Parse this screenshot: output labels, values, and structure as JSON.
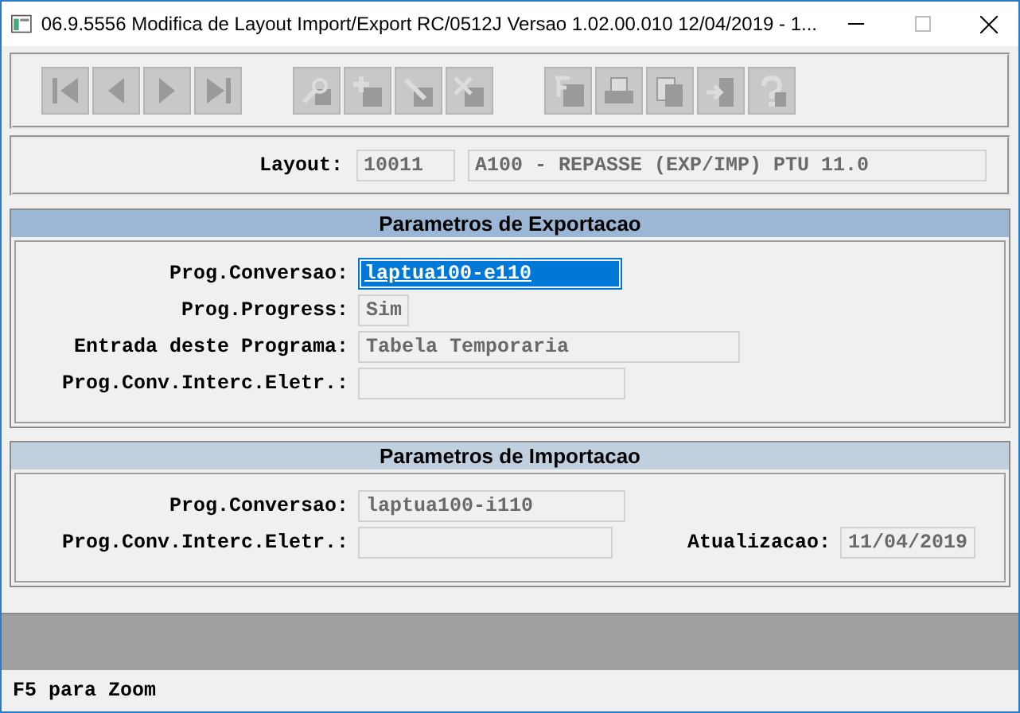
{
  "window": {
    "title": "06.9.5556  Modifica  de Layout Import/Export RC/0512J Versao 1.02.00.010 12/04/2019 - 1..."
  },
  "toolbar": {
    "groups": [
      [
        {
          "kind": "first",
          "disabled": true
        },
        {
          "kind": "prev",
          "disabled": true
        },
        {
          "kind": "next",
          "disabled": true
        },
        {
          "kind": "last",
          "disabled": true
        }
      ],
      [
        {
          "kind": "search",
          "disabled": true
        },
        {
          "kind": "add",
          "disabled": true
        },
        {
          "kind": "edit",
          "disabled": true
        },
        {
          "kind": "delete",
          "disabled": true
        }
      ],
      [
        {
          "kind": "formula",
          "disabled": true
        },
        {
          "kind": "print",
          "disabled": true
        },
        {
          "kind": "copy",
          "disabled": true
        },
        {
          "kind": "exit",
          "disabled": true
        },
        {
          "kind": "help",
          "disabled": true
        }
      ]
    ]
  },
  "layout": {
    "label": "Layout:",
    "code": "10011",
    "description": "A100 - REPASSE (EXP/IMP) PTU 11.0"
  },
  "sections": [
    {
      "title": "Parametros de Exportacao",
      "active": true,
      "fields": [
        {
          "label": "Prog.Conversao:",
          "value": "laptua100-e110",
          "selected": true
        },
        {
          "label": "Prog.Progress:",
          "value": "Sim",
          "selected": false
        },
        {
          "label": "Entrada deste Programa:",
          "value": "Tabela Temporaria",
          "selected": false
        },
        {
          "label": "Prog.Conv.Interc.Eletr.:",
          "selected": false
        }
      ]
    },
    {
      "title": "Parametros de Importacao",
      "active": false,
      "fields": [
        {
          "label": "Prog.Conversao:",
          "value": "laptua100-i110",
          "selected": false
        },
        {
          "label": "Prog.Conv.Interc.Eletr.:",
          "selected": false
        }
      ],
      "side": {
        "label": "Atualizacao:",
        "value": "11/04/2019"
      }
    }
  ],
  "status_bar": {
    "text": "F5 para Zoom"
  }
}
